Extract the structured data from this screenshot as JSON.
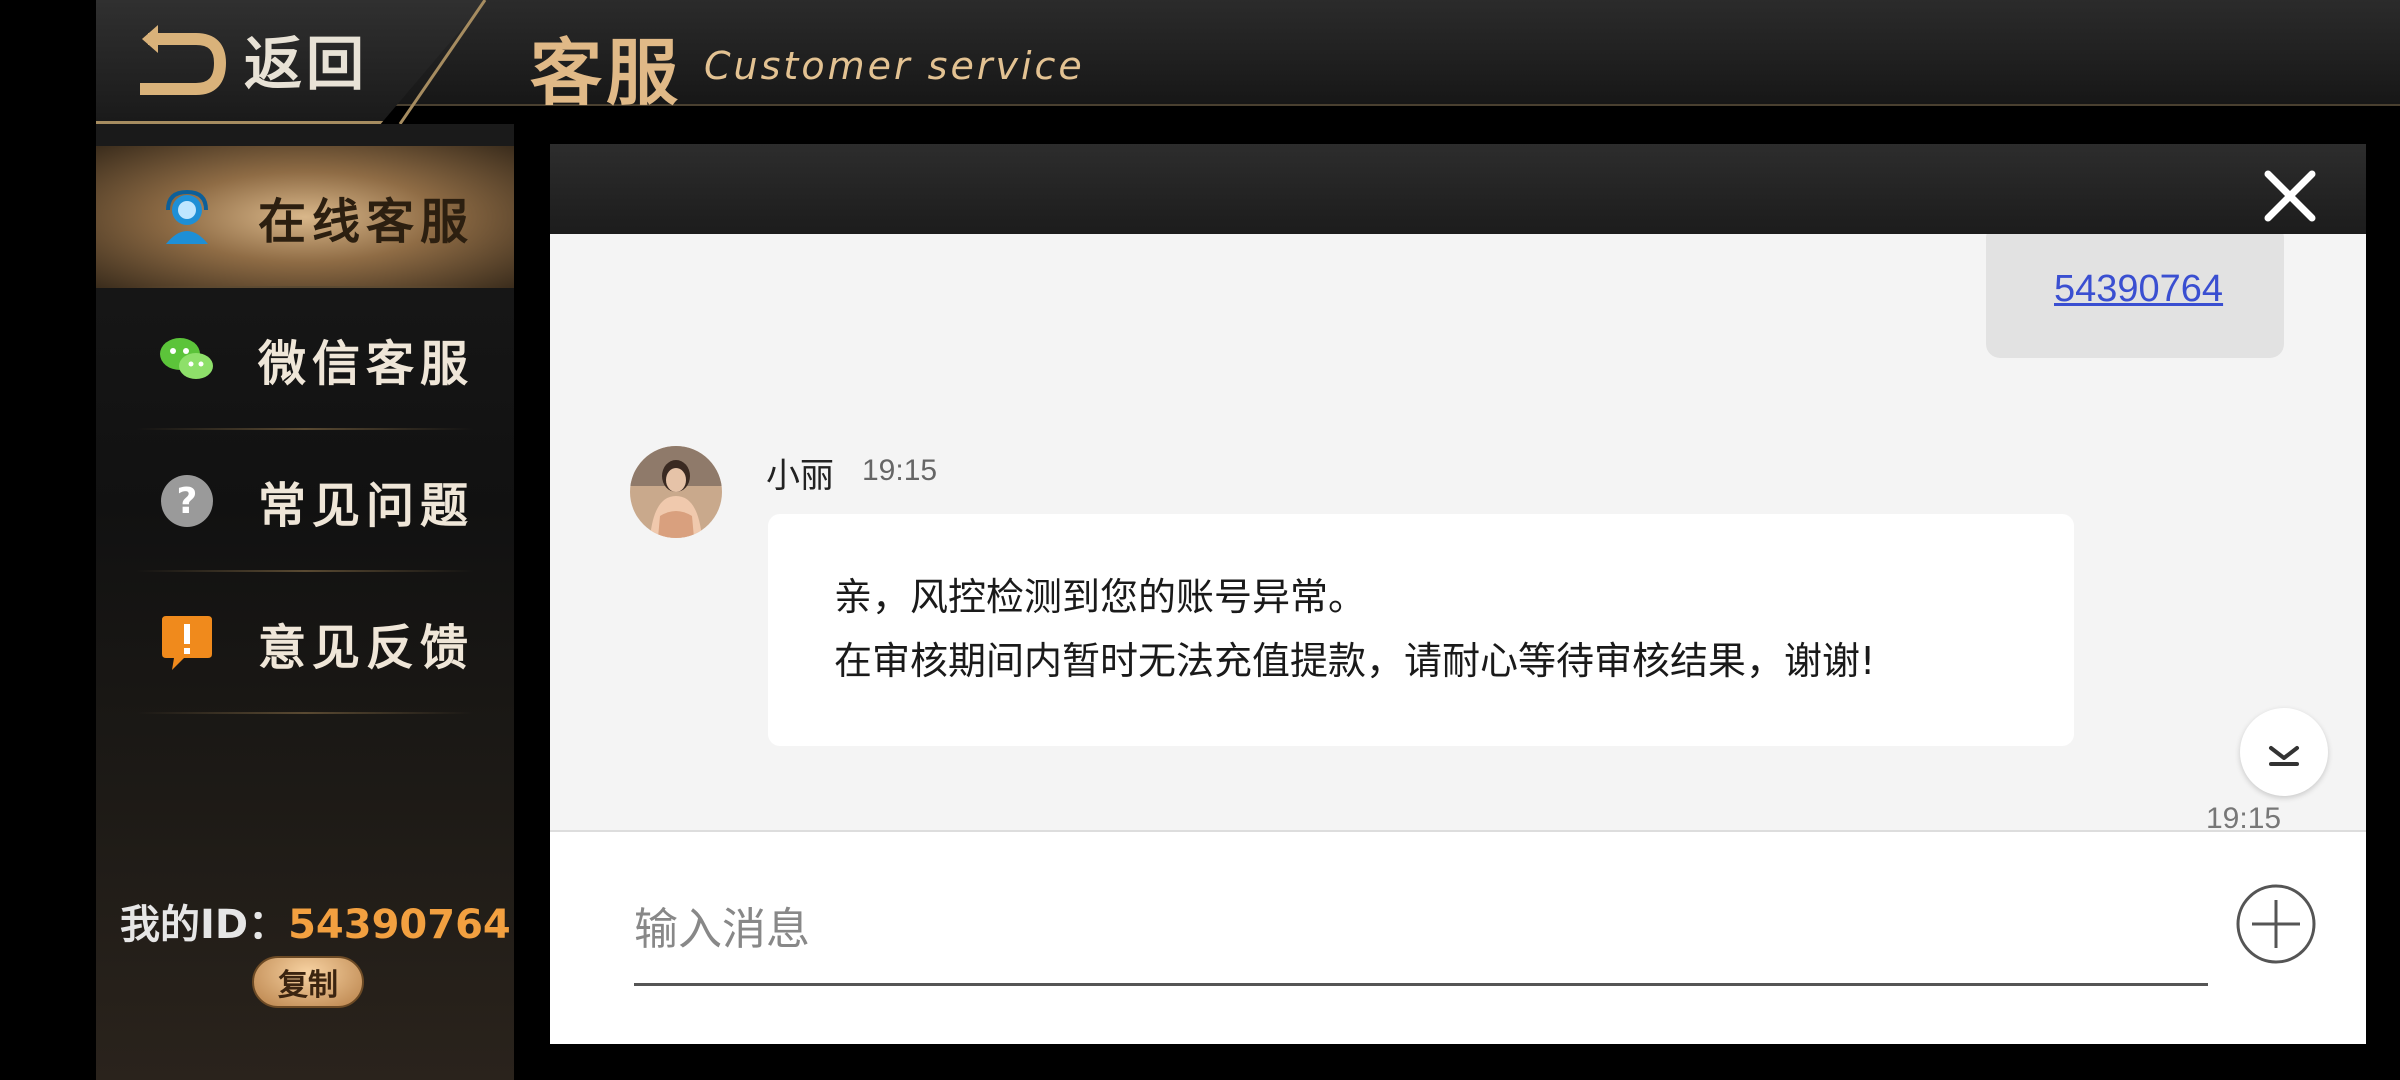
{
  "header": {
    "back_label": "返回",
    "title": "客服",
    "subtitle": "Customer service"
  },
  "sidebar": {
    "items": [
      {
        "label": "在线客服",
        "icon": "agent-icon",
        "active": true
      },
      {
        "label": "微信客服",
        "icon": "wechat-icon",
        "active": false
      },
      {
        "label": "常见问题",
        "icon": "question-icon",
        "active": false
      },
      {
        "label": "意见反馈",
        "icon": "feedback-icon",
        "active": false
      }
    ],
    "my_id_label": "我的ID：",
    "my_id_value": "54390764",
    "copy_label": "复制"
  },
  "chat": {
    "sent_message": "54390764",
    "agent_name": "小丽",
    "agent_time": "19:15",
    "received_lines": [
      "亲，风控检测到您的账号异常。",
      "在审核期间内暂时无法充值提款，请耐心等待审核结果，谢谢!"
    ],
    "bottom_time": "19:15",
    "input_placeholder": "输入消息"
  },
  "colors": {
    "accent_gold": "#e0b987",
    "id_orange": "#f2a040",
    "link_blue": "#3a4fd1"
  }
}
